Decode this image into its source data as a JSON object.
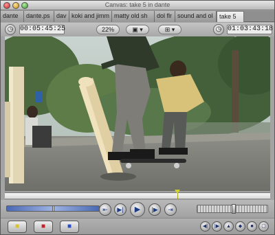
{
  "window": {
    "title": "Canvas: take 5 in dante"
  },
  "tabs": [
    {
      "label": "dante"
    },
    {
      "label": "dante.ps"
    },
    {
      "label": "dav"
    },
    {
      "label": "koki and jimm"
    },
    {
      "label": "matty old sh"
    },
    {
      "label": "dol flr"
    },
    {
      "label": "sound and ol"
    },
    {
      "label": "take 5"
    }
  ],
  "controls": {
    "duration_timecode": "00:05:45:25",
    "zoom_level": "22%",
    "view_options_label": "▣ ▾",
    "overlay_label": "⊞ ▾",
    "current_timecode": "01:03:43:18"
  },
  "transport": {
    "prev_edit": "⇤",
    "play_in_out": "▶|",
    "play": "▶",
    "play_around": "|▶",
    "next_edit": "⇥"
  },
  "bottom": {
    "insert": "■",
    "overwrite": "■",
    "replace": "■",
    "mark_in": "◀|",
    "mark_out": "|▶",
    "add_marker": "▲",
    "add_keyframe": "◆",
    "match_frame": "■",
    "mark_clip": "▢"
  },
  "colors": {
    "accent_blue": "#4a69b3",
    "insert_yellow": "#d9c22b",
    "overwrite_red": "#c8202a",
    "replace_blue": "#2a4cc8"
  },
  "timeline": {
    "playhead_position": 0.65
  }
}
